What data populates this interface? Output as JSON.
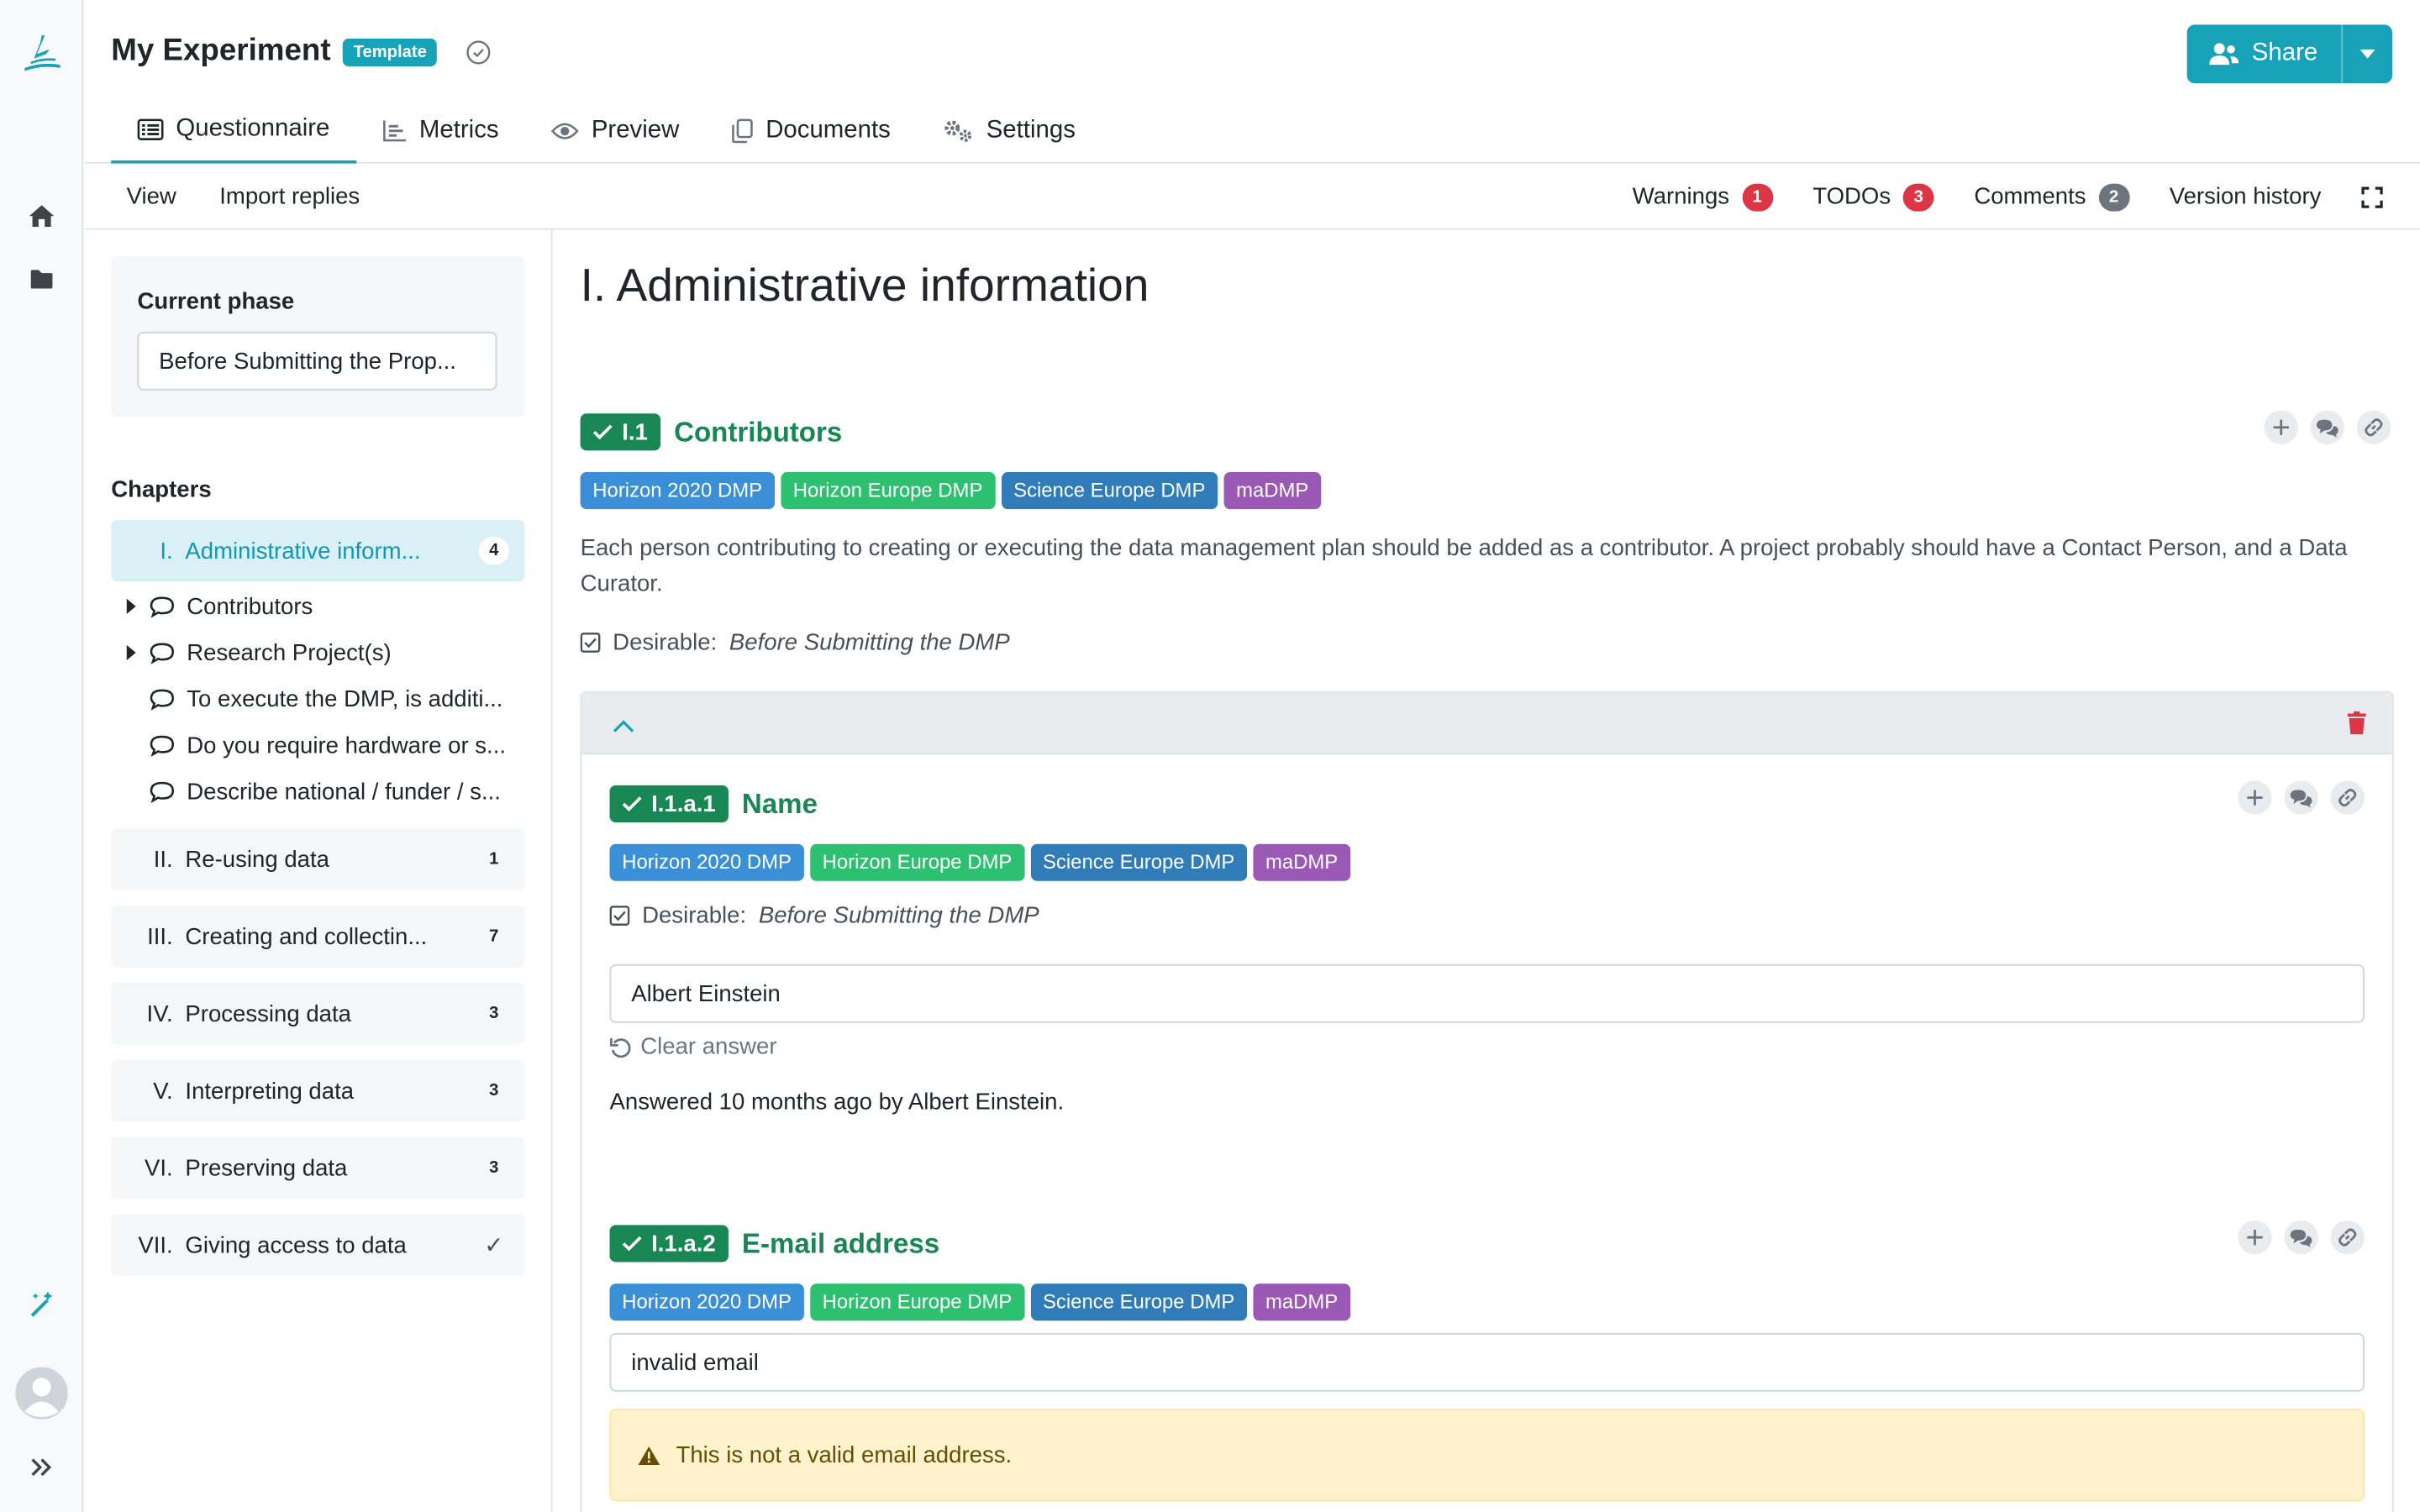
{
  "rail": {
    "icons": [
      "logo-icon",
      "home-icon",
      "folder-icon",
      "wand-icon",
      "avatar",
      "expand-icon"
    ]
  },
  "header": {
    "title": "My Experiment",
    "badge": "Template",
    "share_label": "Share",
    "tabs": [
      {
        "label": "Questionnaire",
        "icon": "list-icon",
        "active": true
      },
      {
        "label": "Metrics",
        "icon": "chart-icon"
      },
      {
        "label": "Preview",
        "icon": "eye-icon"
      },
      {
        "label": "Documents",
        "icon": "copy-icon"
      },
      {
        "label": "Settings",
        "icon": "gears-icon"
      }
    ]
  },
  "toolbar": {
    "view": "View",
    "import": "Import replies",
    "warnings": {
      "label": "Warnings",
      "count": "1"
    },
    "todos": {
      "label": "TODOs",
      "count": "3"
    },
    "comments": {
      "label": "Comments",
      "count": "2"
    },
    "history": "Version history"
  },
  "sidebar": {
    "phase_label": "Current phase",
    "phase_value": "Before Submitting the Prop...",
    "chapters_label": "Chapters",
    "chapters": [
      {
        "num": "I.",
        "name": "Administrative inform...",
        "count": "4",
        "active": true
      },
      {
        "num": "II.",
        "name": "Re-using data",
        "count": "1"
      },
      {
        "num": "III.",
        "name": "Creating and collectin...",
        "count": "7"
      },
      {
        "num": "IV.",
        "name": "Processing data",
        "count": "3"
      },
      {
        "num": "V.",
        "name": "Interpreting data",
        "count": "3"
      },
      {
        "num": "VI.",
        "name": "Preserving data",
        "count": "3"
      },
      {
        "num": "VII.",
        "name": "Giving access to data",
        "count": "✓"
      }
    ],
    "items": [
      {
        "label": "Contributors",
        "caret": true
      },
      {
        "label": "Research Project(s)",
        "caret": true
      },
      {
        "label": "To execute the DMP, is additi..."
      },
      {
        "label": "Do you require hardware or s..."
      },
      {
        "label": "Describe national / funder / s..."
      }
    ]
  },
  "main": {
    "chapter_title": "I. Administrative information",
    "q1": {
      "num": "I.1",
      "title": "Contributors",
      "description": "Each person contributing to creating or executing the data management plan should be added as a contributor. A project probably should have a Contact Person, and a Data Curator.",
      "desirable_label": "Desirable:",
      "desirable_value": "Before Submitting the DMP"
    },
    "tags": [
      {
        "label": "Horizon 2020 DMP",
        "color": "#3a8fd6"
      },
      {
        "label": "Horizon Europe DMP",
        "color": "#2dc070"
      },
      {
        "label": "Science Europe DMP",
        "color": "#2f7cb8"
      },
      {
        "label": "maDMP",
        "color": "#9b59b6"
      }
    ],
    "q1a1": {
      "num": "I.1.a.1",
      "title": "Name",
      "desirable_label": "Desirable:",
      "desirable_value": "Before Submitting the DMP",
      "answer": "Albert Einstein",
      "clear": "Clear answer",
      "answered": "Answered 10 months ago by Albert Einstein."
    },
    "q1a2": {
      "num": "I.1.a.2",
      "title": "E-mail address",
      "answer": "invalid email",
      "warning": "This is not a valid email address."
    }
  },
  "colors": {
    "accent": "#17a2b8",
    "success": "#198754",
    "danger": "#dc3545",
    "warning_bg": "#fff3cd"
  }
}
